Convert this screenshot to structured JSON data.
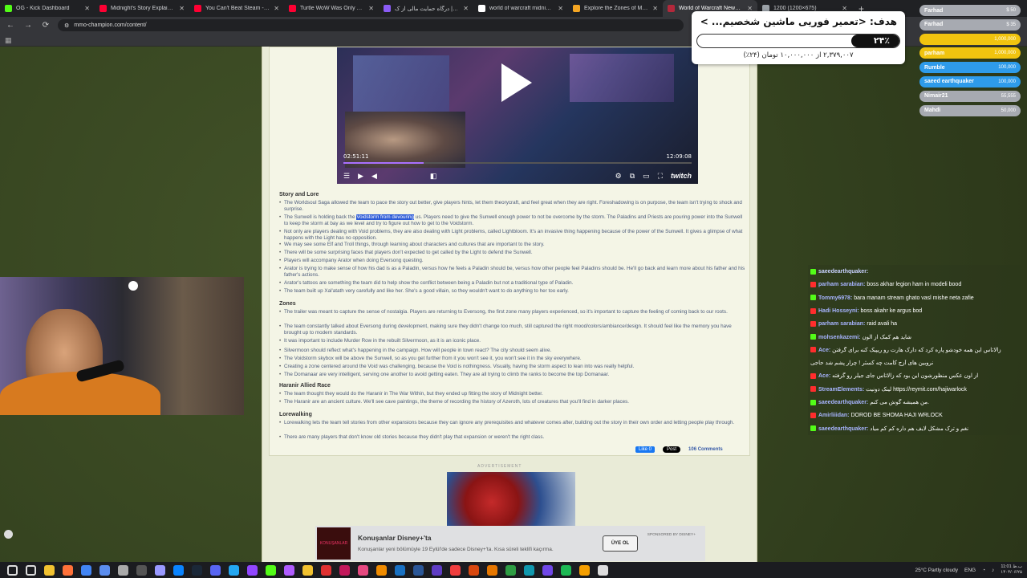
{
  "browser": {
    "tabs": [
      {
        "label": "OG - Kick Dashboard",
        "color": "#53fc18"
      },
      {
        "label": "Midnight's Story Explained In 2",
        "color": "#ff0033"
      },
      {
        "label": "You Can't Beat Steam - YouTube",
        "color": "#ff0033"
      },
      {
        "label": "Turtle WoW Was Only The Begin",
        "color": "#ff0033"
      },
      {
        "label": "ریبیت | درگاه حمایت مالی از ک",
        "color": "#8b5cf6"
      },
      {
        "label": "world of warcraft midnight - Go",
        "color": "#ffffff"
      },
      {
        "label": "Explore the Zones of Midnight",
        "color": "#f5a623"
      },
      {
        "label": "World of Warcraft News and R",
        "color": "#b3283b"
      },
      {
        "label": "1200 (1200×675)",
        "color": "#9aa0a6"
      }
    ],
    "url": "mmo-champion.com/content/"
  },
  "video": {
    "elapsed": "02:51:11",
    "duration": "12:09:08",
    "progress_pct": 23,
    "brand": "twitch"
  },
  "article": {
    "sections": [
      {
        "heading": "Story and Lore",
        "bullets": [
          "The Worldsoul Saga allowed the team to pace the story out better, give players hints, let them theorycraft, and feel great when they are right. Foreshadowing is on purpose, the team isn't trying to shock and surprise.",
          "__SUNWELL__",
          "Not only are players dealing with Void problems, they are also dealing with Light problems, called Lightbloom. It's an invasive thing happening because of the power of the Sunwell. It gives a glimpse of what happens with the Light has no opposition.",
          "We may see some Elf and Troll things, through learning about characters and cultures that are important to the story.",
          "There will be some surprising faces that players don't expected to get called by the Light to defend the Sunwell.",
          "Players will accompany Arator when doing Eversong questing.",
          "Arator is trying to make sense of how his dad is as a Paladin, versus how he feels a Paladin should be, versus how other people feel Paladins should be. He'll go back and learn more about his father and his father's actions.",
          "Arator's tattoos are something the team did to help show the conflict between being a Paladin but not a traditional type of Paladin.",
          "The team built up Xal'atath very carefully and like her. She's a good villain, so they wouldn't want to do anything to her too early."
        ]
      },
      {
        "heading": "Zones",
        "bullets": [
          "The trailer was meant to capture the sense of nostalgia. Players are returning to Eversong, the first zone many players experienced, so it's important to capture the feeling of coming back to our roots.",
          "The team constantly talked about Eversong during development, making sure they didn't change too much, still captured the right mood/colors/ambiance/design. It should feel like the memory you have brought up to modern standards.",
          "It was important to include Murder Row in the rebuilt Silvermoon, as it is an iconic place.",
          "Silvermoon should reflect what's happening in the campaign. How will people in town react? The city should seem alive.",
          "The Voidstorm skybox will be above the Sunwell, so as you get further from it you won't see it, you won't see it in the sky everywhere.",
          "Creating a zone centered around the Void was challenging, because the Void is nothingness. Visually, having the storm aspect to lean into was really helpful.",
          "The Domanaar are very intelligent, serving one another to avoid getting eaten. They are all trying to climb the ranks to become the top Domanaar."
        ]
      },
      {
        "heading": "Haranir Allied Race",
        "bullets": [
          "The team thought they would do the Haranir in The War Within, but they ended up fitting the story of Midnight better.",
          "The Haranir are an ancient culture. We'll see cave paintings, the theme of recording the history of Azeroth, lots of creatures that you'll find in darker places."
        ]
      },
      {
        "heading": "Lorewalking",
        "bullets": [
          "Lorewalking lets the team tell stories from other expansions because they can ignore any prerequisites and whatever comes after, building out the story in their own order and letting people play through.",
          "There are many players that don't know old stories because they didn't play that expansion or weren't the right class."
        ]
      }
    ],
    "sunwell_bullet": {
      "before": "The Sunwell is holding back the ",
      "highlight": "Voidstorm from devouring",
      "after": " us. Players need to give the Sunwell enough power to not be overcome by the storm. The Paladins and Priests are pouring power into the Sunwell to keep the storm at bay as we level and try to figure out how to get to the Voidstorm."
    },
    "like_label": "Like 0",
    "post_label": "Post",
    "comments_label": "106 Comments",
    "ad_label": "ADVERTISEMENT"
  },
  "disney_ad": {
    "title": "Konuşanlar Disney+'ta",
    "subtitle": "Konuşanlar yeni bölümüyle 19 Eylül'de sadece Disney+'ta. Kısa süreli teklifi kaçırma.",
    "sponsor": "SPONSORED BY DISNEY+",
    "button": "ÜYE OL",
    "logo_text": "KONUŞANLAR"
  },
  "goal": {
    "title": "هدف: <تعمیر فوریی ماشین شخصیم... >",
    "percent_label": "٢۴٪",
    "progress_fraction": 0.24,
    "status": "۲,۳۷۹,۰۰۷ از ۱۰,۰۰۰,۰۰۰ تومان (۲۴٪)"
  },
  "donors": [
    {
      "name": "Farhad",
      "value": "$ 50",
      "color": "#a7aab1"
    },
    {
      "name": "Farhad",
      "value": "$ 35",
      "color": "#a7aab1"
    },
    {
      "name": "",
      "value": "1,000,000",
      "color": "#f1c40f"
    },
    {
      "name": "parham",
      "value": "1,000,000",
      "color": "#f1c40f"
    },
    {
      "name": "Rumble",
      "value": "100,000",
      "color": "#2e9bea"
    },
    {
      "name": "saeed earthquaker",
      "value": "100,000",
      "color": "#2e9bea"
    },
    {
      "name": "Nimair21",
      "value": "55,555",
      "color": "#a7aab1"
    },
    {
      "name": "Mahdi",
      "value": "50,000",
      "color": "#a7aab1"
    }
  ],
  "chat": [
    {
      "user": "saeedearthquaker:",
      "text": "",
      "badge": "#53fc18",
      "ucolor": "#c9d2ff"
    },
    {
      "user": "parham sarabian:",
      "text": "boss akhar legion ham in modeli bood",
      "badge": "#ff2d2d",
      "ucolor": "#a7b4ff"
    },
    {
      "user": "Tommy6978:",
      "text": "bara manam stream ghato vasl mishe neta zafie",
      "badge": "#53fc18",
      "ucolor": "#a7b4ff"
    },
    {
      "user": "Hadi Hosseyni:",
      "text": "boss akahr ke argus bod",
      "badge": "#ff2d2d",
      "ucolor": "#a7b4ff"
    },
    {
      "user": "parham sarabian:",
      "text": "raid avali ha",
      "badge": "#ff2d2d",
      "ucolor": "#a7b4ff"
    },
    {
      "user": "mohsenkazemi:",
      "text": "شاید هم کمک از الون",
      "badge": "#53fc18",
      "ucolor": "#a7b4ff"
    },
    {
      "user": "Ace:",
      "text": "زالاتاس این همه خودشو پاره کرد که دارک هارت رو ریپیک کنه برای گرفتن",
      "badge": "#ff2d2d",
      "ucolor": "#a7b4ff"
    },
    {
      "user": "",
      "text": "نروبین های آزج کامت چه کسثر ! چرار پشم شد حاجی",
      "badge": "",
      "ucolor": "#a7b4ff"
    },
    {
      "user": "Ace:",
      "text": "از اون عکس منظورشون این بود که زالاتاس جای جیلر رو گرفته",
      "badge": "#ff2d2d",
      "ucolor": "#a7b4ff"
    },
    {
      "user": "StreamElements:",
      "text": "لینک دونیت https://reymit.com/hajiwarlock",
      "badge": "#ff2d2d",
      "ucolor": "#a7b4ff"
    },
    {
      "user": "saeedearthquaker:",
      "text": "من همیشه گوش می کنم.",
      "badge": "#53fc18",
      "ucolor": "#a7b4ff"
    },
    {
      "user": "Amirliiidan:",
      "text": "DOROD BE SHOMA HAJI WRLOCK",
      "badge": "#ff2d2d",
      "ucolor": "#a7b4ff"
    },
    {
      "user": "saeedearthquaker:",
      "text": "نغم و ترک مشکل لایف هم داره کم کم میاد",
      "badge": "#53fc18",
      "ucolor": "#a7b4ff"
    }
  ],
  "taskbar": {
    "weather": "25°C  Partly cloudy",
    "lang": "ENG",
    "time": "11:01 ب.ظ",
    "date": "۱۴۰۴/۰۶/۲۵",
    "icons": [
      "start-icon",
      "search-icon",
      "file-explorer-icon",
      "firefox-icon",
      "chrome-icon",
      "app-icon-1",
      "settings-icon",
      "obs-icon",
      "premiere-icon",
      "edge-icon",
      "steam-icon",
      "discord-icon",
      "vscode-icon",
      "twitch-icon",
      "kick-icon",
      "app-icon-2",
      "folder-icon",
      "app-icon-3",
      "app-icon-4",
      "app-icon-5",
      "winamp-icon",
      "chart-icon",
      "word-icon",
      "app-icon-6",
      "app-icon-7",
      "pdf-icon",
      "app-icon-8",
      "app-icon-9",
      "app-icon-10",
      "app-icon-11",
      "spotify-icon",
      "app-icon-12",
      "app-icon-13"
    ]
  }
}
